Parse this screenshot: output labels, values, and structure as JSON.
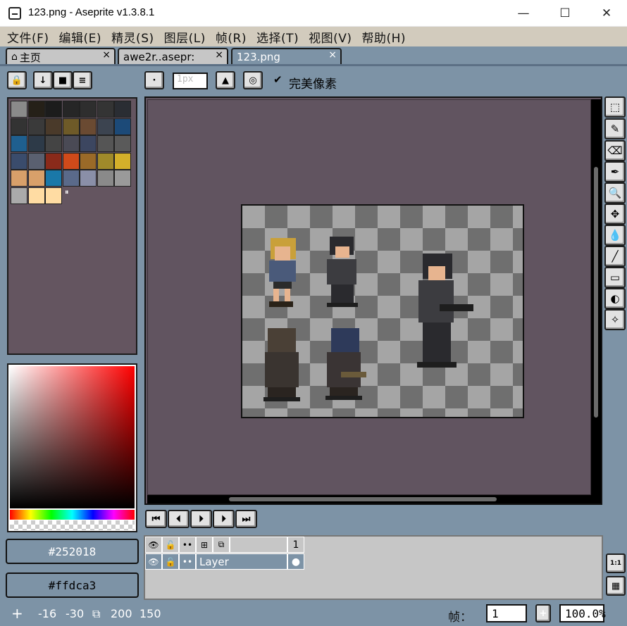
{
  "window": {
    "title": "123.png - Aseprite v1.3.8.1",
    "minimize": "—",
    "maximize": "☐",
    "close": "✕"
  },
  "menu": [
    "文件(F)",
    "编辑(E)",
    "精灵(S)",
    "图层(L)",
    "帧(R)",
    "选择(T)",
    "视图(V)",
    "帮助(H)"
  ],
  "tabs": [
    {
      "label": "主页",
      "close": "×"
    },
    {
      "label": "awe2r..asepr:",
      "close": "×"
    },
    {
      "label": "123.png",
      "close": "×"
    }
  ],
  "context_bar": {
    "brush_size": "1px",
    "pixel_perfect_check": "✔",
    "pixel_perfect_label": "完美像素"
  },
  "palette": {
    "colors": [
      "#8a8a8a",
      "#252018",
      "#1c1c1c",
      "#262626",
      "#2e2e2e",
      "#343434",
      "#2a2d33",
      "#333333",
      "#3a3a3a",
      "#4a3a2a",
      "#6e5a28",
      "#6a4a32",
      "#3c4450",
      "#1c4a78",
      "#1f5f8f",
      "#2d3a48",
      "#444444",
      "#4a4a55",
      "#3c4660",
      "#555555",
      "#5a5a5a",
      "#3a4c6c",
      "#5a6070",
      "#8a2a1a",
      "#d04a1a",
      "#9a6a28",
      "#a08a2a",
      "#d4b02a",
      "#d8a06a",
      "#d8a06a",
      "#1a78a8",
      "#5a6a8a",
      "#8a8fa8",
      "#8a8a8a",
      "#9a9a9a",
      "#aaaaaa",
      "#ffdca3",
      "#ffdca3"
    ],
    "more_marker": "⏸"
  },
  "colors": {
    "foreground": "#252018",
    "background": "#ffdca3"
  },
  "tools": [
    "⬚",
    "✎",
    "⌫",
    "✒",
    "🔍",
    "✥",
    "💧",
    "╱",
    "▭",
    "◐",
    "✧"
  ],
  "tool_names": [
    "marquee",
    "pencil",
    "eraser",
    "eyedropper",
    "zoom",
    "move",
    "bucket",
    "line",
    "rectangle",
    "contour",
    "spray"
  ],
  "animation_buttons": [
    "⏮",
    "⏴",
    "⏵",
    "⏵",
    "⏭"
  ],
  "timeline": {
    "frame_number": "1",
    "layer_name": "Layer",
    "cel_marker": "●"
  },
  "side_buttons": [
    "1:1",
    "▦"
  ],
  "status": {
    "move_icon": "+",
    "x": "-16",
    "y": "-30",
    "size_icon": "⧉",
    "width": "200",
    "height": "150",
    "frame_label": "帧：",
    "frame_value": "1",
    "plus": "+",
    "zoom": "100.0%"
  }
}
